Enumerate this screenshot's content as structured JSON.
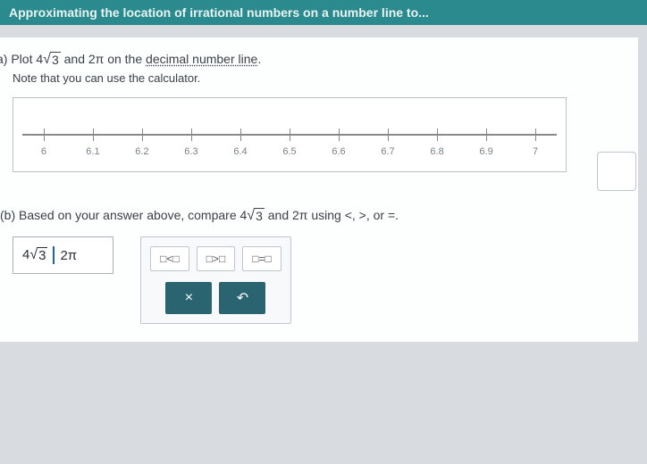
{
  "header": {
    "title": "Approximating the location of irrational numbers on a number line to..."
  },
  "partA": {
    "marker": "a)",
    "textPre": "Plot ",
    "expr1_coef": "4",
    "expr1_rad": "3",
    "textMid": " and 2π on the ",
    "link": "decimal number line",
    "textEnd": ".",
    "sub": "Note that you can use the calculator."
  },
  "ticks": [
    "6",
    "6.1",
    "6.2",
    "6.3",
    "6.4",
    "6.5",
    "6.6",
    "6.7",
    "6.8",
    "6.9",
    "7"
  ],
  "partB": {
    "marker": "(b)",
    "textPre": " Based on your answer above, compare ",
    "expr1_coef": "4",
    "expr1_rad": "3",
    "textMid": " and 2π using <, >, or =."
  },
  "answer": {
    "left_coef": "4",
    "left_rad": "3",
    "right": "2π"
  },
  "ops": {
    "lt": "□<□",
    "gt": "□>□",
    "eq": "□=□",
    "x": "×",
    "undo": "↶"
  }
}
